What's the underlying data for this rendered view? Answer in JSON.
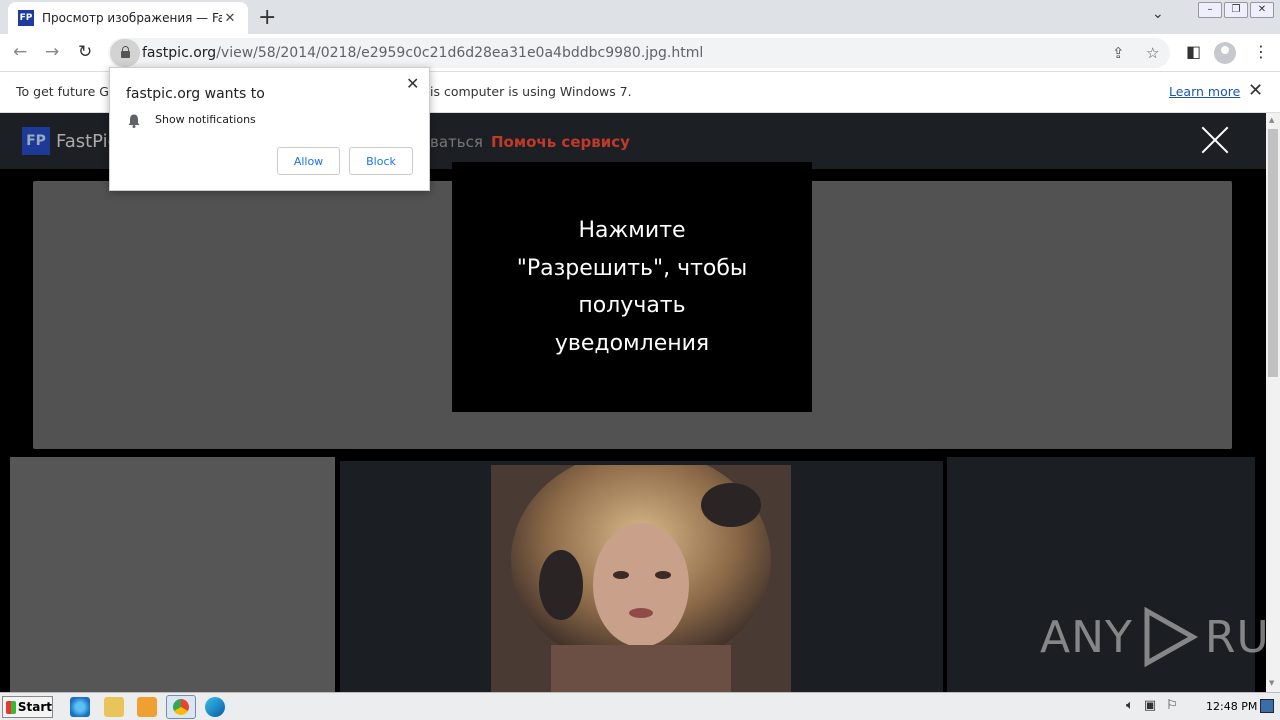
{
  "browser": {
    "tab_title": "Просмотр изображения — FastPic",
    "tab_favicon": "FP",
    "new_tab_icon": "+",
    "url_domain": "fastpic.org",
    "url_path": "/view/58/2014/0218/e2959c0c21d6d28ea31e0a4bddbc9980.jpg.html"
  },
  "infobar": {
    "text_left": "To get future Go",
    "text_right": "is computer is using Windows 7.",
    "learn_more": "Learn more"
  },
  "site": {
    "logo_mark": "FP",
    "logo_text": "FastPic",
    "nav_partial": "ваться",
    "help_link": "Помочь сервису"
  },
  "modal": {
    "lines": [
      "Нажмите",
      "\"Разрешить\", чтобы",
      "получать",
      "уведомления"
    ]
  },
  "permission_popup": {
    "title": "fastpic.org wants to",
    "permission": "Show notifications",
    "allow": "Allow",
    "block": "Block"
  },
  "watermark": {
    "left": "ANY",
    "right": "RUN"
  },
  "taskbar": {
    "start": "Start",
    "clock": "12:48 PM"
  },
  "colors": {
    "help_link": "#c0392b",
    "logo_bg": "#1e3a99",
    "link_blue": "#1a73e8"
  }
}
